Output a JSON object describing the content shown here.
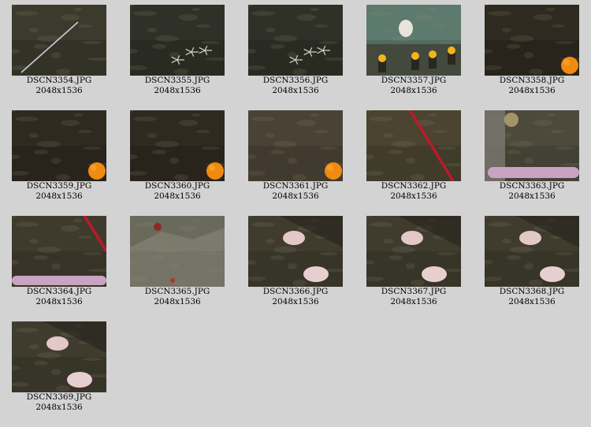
{
  "gallery": {
    "items": [
      {
        "filename": "DSCN3354.JPG",
        "dimensions": "2048x1536",
        "scene": "dark-seafloor-cable"
      },
      {
        "filename": "DSCN3355.JPG",
        "dimensions": "2048x1536",
        "scene": "dark-seafloor-starfish"
      },
      {
        "filename": "DSCN3356.JPG",
        "dimensions": "2048x1536",
        "scene": "dark-seafloor-starfish"
      },
      {
        "filename": "DSCN3357.JPG",
        "dimensions": "2048x1536",
        "scene": "teal-reef-yellow-sponges"
      },
      {
        "filename": "DSCN3358.JPG",
        "dimensions": "2048x1536",
        "scene": "dark-reef-orange-coral"
      },
      {
        "filename": "DSCN3359.JPG",
        "dimensions": "2048x1536",
        "scene": "dark-reef-orange-coral"
      },
      {
        "filename": "DSCN3360.JPG",
        "dimensions": "2048x1536",
        "scene": "dark-reef-orange-coral"
      },
      {
        "filename": "DSCN3361.JPG",
        "dimensions": "2048x1536",
        "scene": "reef-orange-coral"
      },
      {
        "filename": "DSCN3362.JPG",
        "dimensions": "2048x1536",
        "scene": "seafloor-red-rope"
      },
      {
        "filename": "DSCN3363.JPG",
        "dimensions": "2048x1536",
        "scene": "seafloor-rock-pink-arm"
      },
      {
        "filename": "DSCN3364.JPG",
        "dimensions": "2048x1536",
        "scene": "seafloor-red-rope-pink-arm"
      },
      {
        "filename": "DSCN3365.JPG",
        "dimensions": "2048x1536",
        "scene": "grey-rocks-crab"
      },
      {
        "filename": "DSCN3366.JPG",
        "dimensions": "2048x1536",
        "scene": "seafloor-pink-anemone"
      },
      {
        "filename": "DSCN3367.JPG",
        "dimensions": "2048x1536",
        "scene": "seafloor-pink-anemone"
      },
      {
        "filename": "DSCN3368.JPG",
        "dimensions": "2048x1536",
        "scene": "seafloor-pink-anemone"
      },
      {
        "filename": "DSCN3369.JPG",
        "dimensions": "2048x1536",
        "scene": "seafloor-pink-anemone"
      }
    ]
  },
  "colors": {
    "background": "#d3d3d3",
    "caption_text": "#000000"
  }
}
